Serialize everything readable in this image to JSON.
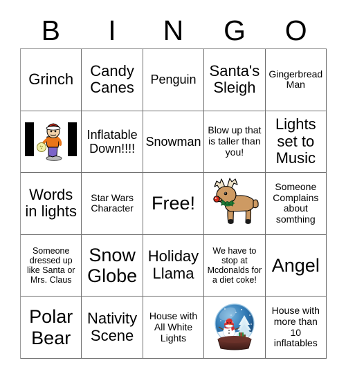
{
  "header": {
    "letters": [
      "B",
      "I",
      "N",
      "G",
      "O"
    ]
  },
  "colors": {
    "grid_line": "#6f6f6f",
    "text": "#000000",
    "background": "#ffffff",
    "reindeer_body": "#CD9A63",
    "reindeer_nose": "#D82A18",
    "reindeer_bow": "#1E7A35",
    "globe_glass": "#2E73AE",
    "globe_base": "#5A2A24",
    "snowman_hat": "#D22E2E",
    "bowler_shirt": "#E8751A",
    "bowler_pants": "#7B63C8",
    "bowler_hat": "#D82A18",
    "bowler_ball": "#F2EFA6"
  },
  "grid": {
    "rows": 5,
    "columns": 5,
    "cells": [
      {
        "row": 1,
        "col": 1,
        "type": "text",
        "text": "Grinch",
        "size": "lg"
      },
      {
        "row": 1,
        "col": 2,
        "type": "text",
        "text": "Candy Canes",
        "size": "lg"
      },
      {
        "row": 1,
        "col": 3,
        "type": "text",
        "text": "Penguin",
        "size": "md"
      },
      {
        "row": 1,
        "col": 4,
        "type": "text",
        "text": "Santa's Sleigh",
        "size": "lg"
      },
      {
        "row": 1,
        "col": 5,
        "type": "text",
        "text": "Gingerbread Man",
        "size": "sm"
      },
      {
        "row": 2,
        "col": 1,
        "type": "image",
        "image": "bowler-with-santa-hat",
        "alt": "Bowler with Santa hat between two black bars"
      },
      {
        "row": 2,
        "col": 2,
        "type": "text",
        "text": "Inflatable Down!!!!",
        "size": "md"
      },
      {
        "row": 2,
        "col": 3,
        "type": "text",
        "text": "Snowman",
        "size": "md"
      },
      {
        "row": 2,
        "col": 4,
        "type": "text",
        "text": "Blow up that is taller than you!",
        "size": "sm"
      },
      {
        "row": 2,
        "col": 5,
        "type": "text",
        "text": "Lights set to Music",
        "size": "lg"
      },
      {
        "row": 3,
        "col": 1,
        "type": "text",
        "text": "Words in lights",
        "size": "lg"
      },
      {
        "row": 3,
        "col": 2,
        "type": "text",
        "text": "Star Wars Character",
        "size": "sm"
      },
      {
        "row": 3,
        "col": 3,
        "type": "text",
        "text": "Free!",
        "size": "xl"
      },
      {
        "row": 3,
        "col": 4,
        "type": "image",
        "image": "reindeer",
        "alt": "Reindeer with red nose and green bow"
      },
      {
        "row": 3,
        "col": 5,
        "type": "text",
        "text": "Someone Complains about somthing",
        "size": "sm"
      },
      {
        "row": 4,
        "col": 1,
        "type": "text",
        "text": "Someone dressed up like Santa or Mrs. Claus",
        "size": "xs"
      },
      {
        "row": 4,
        "col": 2,
        "type": "text",
        "text": "Snow Globe",
        "size": "xl"
      },
      {
        "row": 4,
        "col": 3,
        "type": "text",
        "text": "Holiday Llama",
        "size": "lg"
      },
      {
        "row": 4,
        "col": 4,
        "type": "text",
        "text": "We have to stop at Mcdonalds for a diet coke!",
        "size": "xs"
      },
      {
        "row": 4,
        "col": 5,
        "type": "text",
        "text": "Angel",
        "size": "xl"
      },
      {
        "row": 5,
        "col": 1,
        "type": "text",
        "text": "Polar Bear",
        "size": "xl"
      },
      {
        "row": 5,
        "col": 2,
        "type": "text",
        "text": "Nativity Scene",
        "size": "lg"
      },
      {
        "row": 5,
        "col": 3,
        "type": "text",
        "text": "House with All White Lights",
        "size": "sm"
      },
      {
        "row": 5,
        "col": 4,
        "type": "image",
        "image": "snow-globe",
        "alt": "Snow globe with snowman and Christmas tree"
      },
      {
        "row": 5,
        "col": 5,
        "type": "text",
        "text": "House with more than 10 inflatables",
        "size": "sm"
      }
    ]
  }
}
